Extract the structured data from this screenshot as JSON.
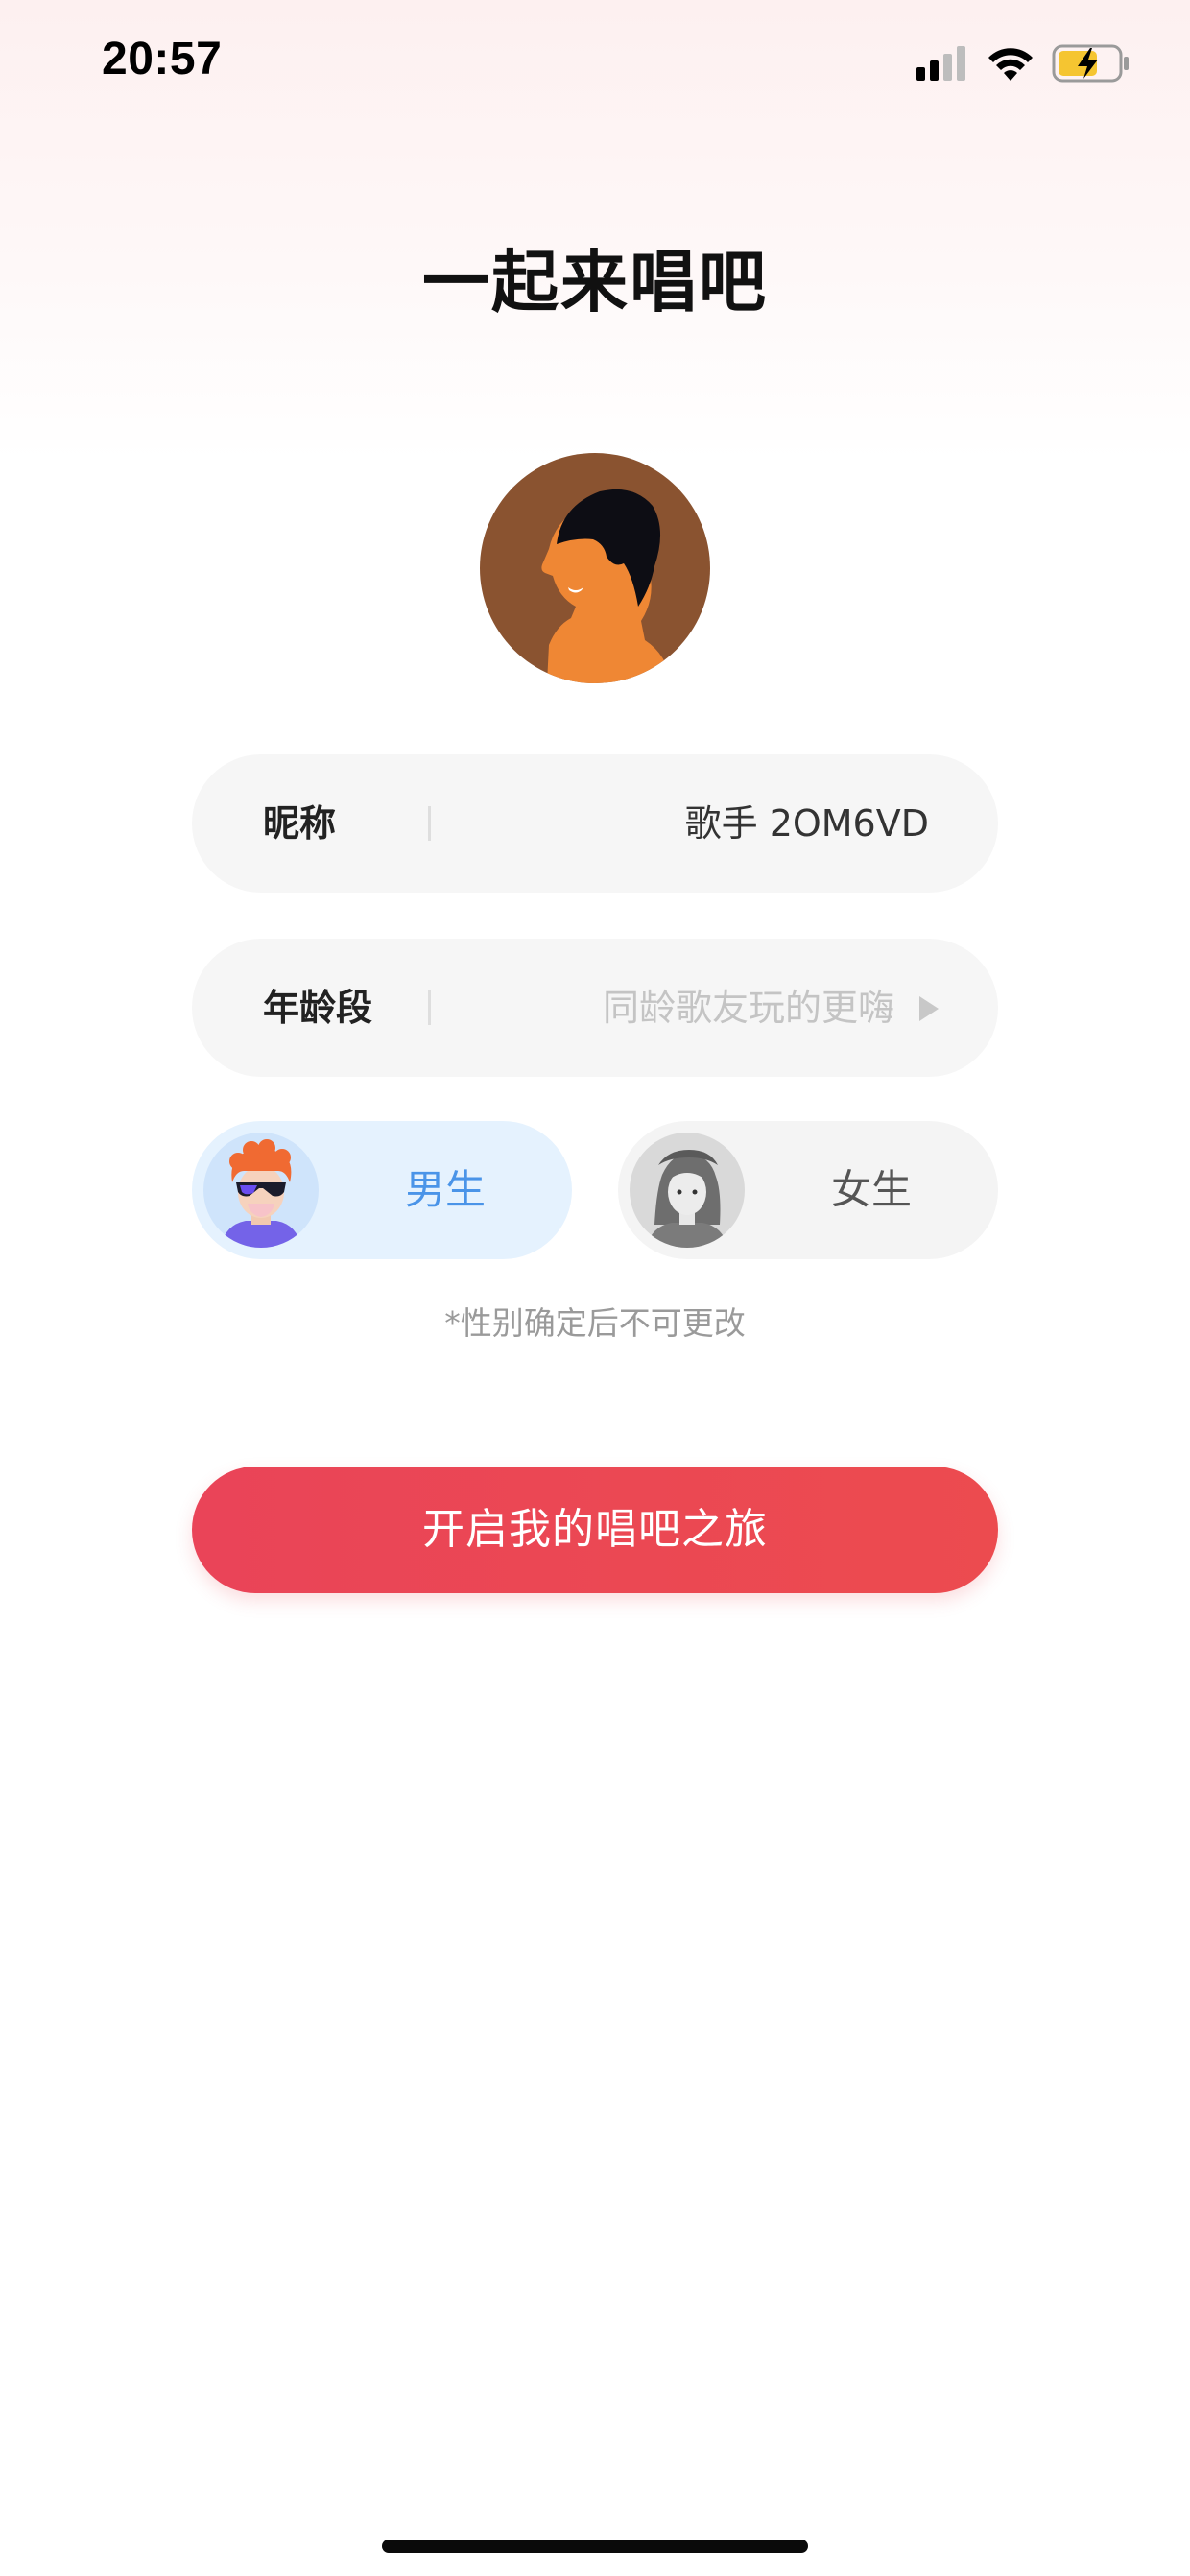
{
  "status_bar": {
    "time": "20:57"
  },
  "page": {
    "title": "一起来唱吧"
  },
  "avatar": {
    "description_icon": "profile-avatar-icon"
  },
  "nickname": {
    "label": "昵称",
    "value": "歌手 2OM6VD"
  },
  "age": {
    "label": "年龄段",
    "placeholder": "同龄歌友玩的更嗨"
  },
  "gender": {
    "male_label": "男生",
    "female_label": "女生",
    "selected": "男生",
    "note": "*性别确定后不可更改"
  },
  "cta": {
    "label": "开启我的唱吧之旅"
  },
  "colors": {
    "accent": "#EA4458",
    "male_selected_bg": "#E5F2FE",
    "male_label": "#4A94E8"
  }
}
